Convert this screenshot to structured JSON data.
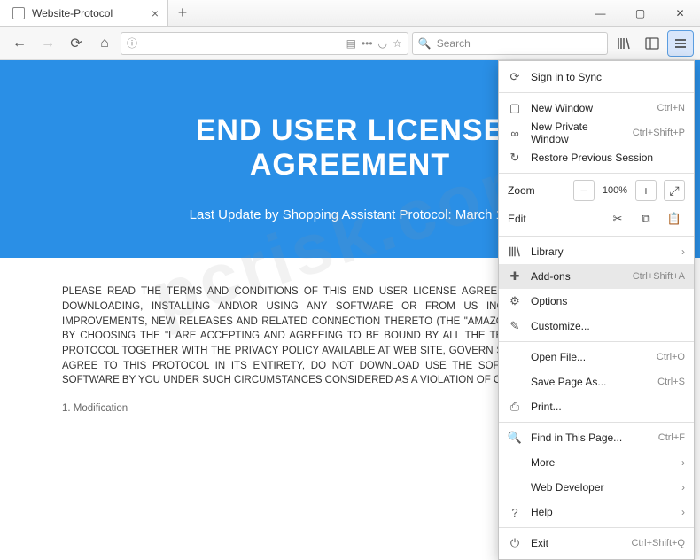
{
  "window": {
    "tab_title": "Website-Protocol",
    "search_placeholder": "Search"
  },
  "page": {
    "hero_title_l1": "END USER LICENSE",
    "hero_title_l2": "AGREEMENT",
    "hero_sub": "Last Update by Shopping Assistant Protocol: March 12",
    "body": "PLEASE READ THE TERMS AND CONDITIONS OF THIS END USER LICENSE AGREEMENT CAREFULLY BEFORE DOWNLOADING, INSTALLING AND\\OR USING ANY SOFTWARE OR FROM US INCLUDING ANY REVISIONS, IMPROVEMENTS, NEW RELEASES AND RELATED CONNECTION THERETO (THE \"AMAZON SHOPPING ASSISTANT\"). BY CHOOSING THE \"I ARE ACCEPTING AND AGREEING TO BE BOUND BY ALL THE TERMS AND CONDITIONS OF PROTOCOL TOGETHER WITH THE PRIVACY POLICY AVAILABLE AT WEB SITE, GOVERN SOFTWARE. IF YOU DO NOT AGREE TO THIS PROTOCOL IN ITS ENTIRETY, DO NOT DOWNLOAD USE THE SOFTWARE. ANY USE OF THE SOFTWARE BY YOU UNDER SUCH CIRCUMSTANCES CONSIDERED AS A VIOLATION OF OUR LEGAL RIGHTS.",
    "section1": "1. Modification"
  },
  "menu": {
    "sign_in": "Sign in to Sync",
    "new_window": "New Window",
    "new_window_sc": "Ctrl+N",
    "new_private": "New Private Window",
    "new_private_sc": "Ctrl+Shift+P",
    "restore": "Restore Previous Session",
    "zoom_label": "Zoom",
    "zoom_pct": "100%",
    "edit_label": "Edit",
    "library": "Library",
    "addons": "Add-ons",
    "addons_sc": "Ctrl+Shift+A",
    "options": "Options",
    "customize": "Customize...",
    "open_file": "Open File...",
    "open_file_sc": "Ctrl+O",
    "save_page": "Save Page As...",
    "save_page_sc": "Ctrl+S",
    "print": "Print...",
    "find": "Find in This Page...",
    "find_sc": "Ctrl+F",
    "more": "More",
    "webdev": "Web Developer",
    "help": "Help",
    "exit": "Exit",
    "exit_sc": "Ctrl+Shift+Q"
  },
  "watermark": "pcrisk.com"
}
